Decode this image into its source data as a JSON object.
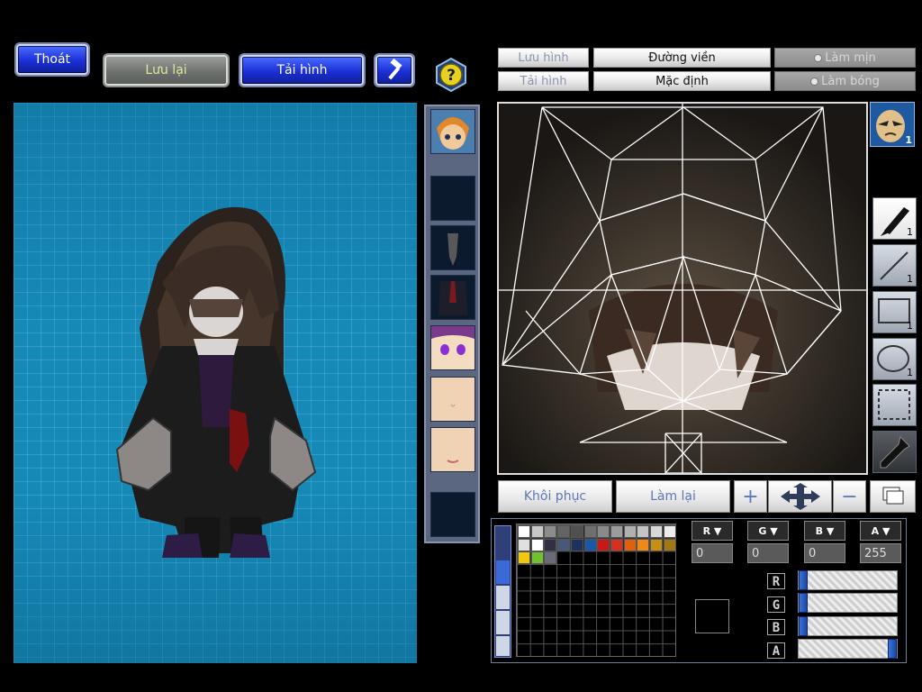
{
  "topbar": {
    "exit_label": "Thoát",
    "save_label": "Lưu lại",
    "load_label": "Tải hình",
    "hammer_icon": "hammer-icon",
    "help_icon": "question-mark-icon"
  },
  "editor_toolbar": {
    "save_image_label": "Lưu hình",
    "load_image_label": "Tải hình",
    "outline_label": "Đường viền",
    "default_label": "Mặc định",
    "smooth_label": "Làm mịn",
    "shade_label": "Làm bóng"
  },
  "character_slots": [
    {
      "name": "hair-orange"
    },
    {
      "name": "empty"
    },
    {
      "name": "cloak-accessory"
    },
    {
      "name": "outfit-dark"
    },
    {
      "name": "face-purple-eyes"
    },
    {
      "name": "face-plain"
    },
    {
      "name": "face-smile"
    },
    {
      "name": "empty"
    }
  ],
  "preview_face_count": "1",
  "tools": [
    {
      "icon": "pen-icon",
      "count": "1",
      "active": true
    },
    {
      "icon": "line-icon",
      "count": "1"
    },
    {
      "icon": "rectangle-icon",
      "count": "1"
    },
    {
      "icon": "ellipse-icon",
      "count": "1"
    },
    {
      "icon": "selection-icon",
      "count": ""
    },
    {
      "icon": "eyedropper-icon",
      "count": ""
    }
  ],
  "bottom_actions": {
    "restore_label": "Khôi phục",
    "redo_label": "Làm lại",
    "zoom_in_symbol": "+",
    "zoom_out_symbol": "−"
  },
  "palette": {
    "row1": [
      "#ffffff",
      "#c8c8c8",
      "#8c8c8c",
      "#646464",
      "#505050",
      "#6e6e6e",
      "#8a8a8a",
      "#9c9c9c",
      "#b0b0b0",
      "#c4c4c4",
      "#d8d8d8",
      "#ececec"
    ],
    "row2": [
      "#e0e0e0",
      "#ffffff",
      "#303040",
      "#48587a",
      "#203060",
      "#1a58a8",
      "#c81818",
      "#d83020",
      "#e06010",
      "#f08818",
      "#c89010",
      "#a07818"
    ],
    "row3": [
      "#f0c810",
      "#70c030",
      "#6a6a7a"
    ]
  },
  "channels": {
    "r_label": "R",
    "g_label": "G",
    "b_label": "B",
    "a_label": "A",
    "r_value": "0",
    "g_value": "0",
    "b_value": "0",
    "a_value": "255"
  },
  "sliders": {
    "r": 0,
    "g": 0,
    "b": 0,
    "a": 255
  }
}
